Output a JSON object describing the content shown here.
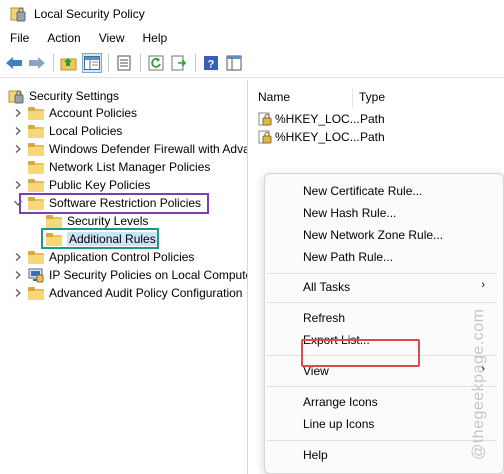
{
  "window": {
    "title": "Local Security Policy"
  },
  "menubar": [
    "File",
    "Action",
    "View",
    "Help"
  ],
  "toolbar": {
    "buttons": [
      "back-arrow-icon",
      "forward-arrow-icon",
      "up-folder-icon",
      "show-hide-tree-icon",
      "properties-icon",
      "refresh-icon",
      "export-list-icon",
      "help-icon",
      "console-icon"
    ]
  },
  "tree": {
    "root": "Security Settings",
    "items": [
      {
        "label": "Account Policies"
      },
      {
        "label": "Local Policies"
      },
      {
        "label": "Windows Defender Firewall with Adva"
      },
      {
        "label": "Network List Manager Policies"
      },
      {
        "label": "Public Key Policies"
      },
      {
        "label": "Software Restriction Policies"
      },
      {
        "label": "Security Levels"
      },
      {
        "label": "Additional Rules"
      },
      {
        "label": "Application Control Policies"
      },
      {
        "label": "IP Security Policies on Local Compute"
      },
      {
        "label": "Advanced Audit Policy Configuration"
      }
    ]
  },
  "list": {
    "columns": [
      "Name",
      "Type"
    ],
    "rows": [
      {
        "name": "%HKEY_LOC...",
        "type": "Path"
      },
      {
        "name": "%HKEY_LOC...",
        "type": "Path"
      }
    ]
  },
  "context_menu": {
    "items": [
      "New Certificate Rule...",
      "New Hash Rule...",
      "New Network Zone Rule...",
      "New Path Rule...",
      "All Tasks",
      "Refresh",
      "Export List...",
      "View",
      "Arrange Icons",
      "Line up Icons",
      "Help"
    ],
    "submenu_arrow": "›"
  },
  "watermark": "@thegeekpage.com",
  "colors": {
    "purple": "#7a3fb0",
    "green": "#1e9a82",
    "red": "#e04a4a",
    "folder": "#f6d77a"
  }
}
